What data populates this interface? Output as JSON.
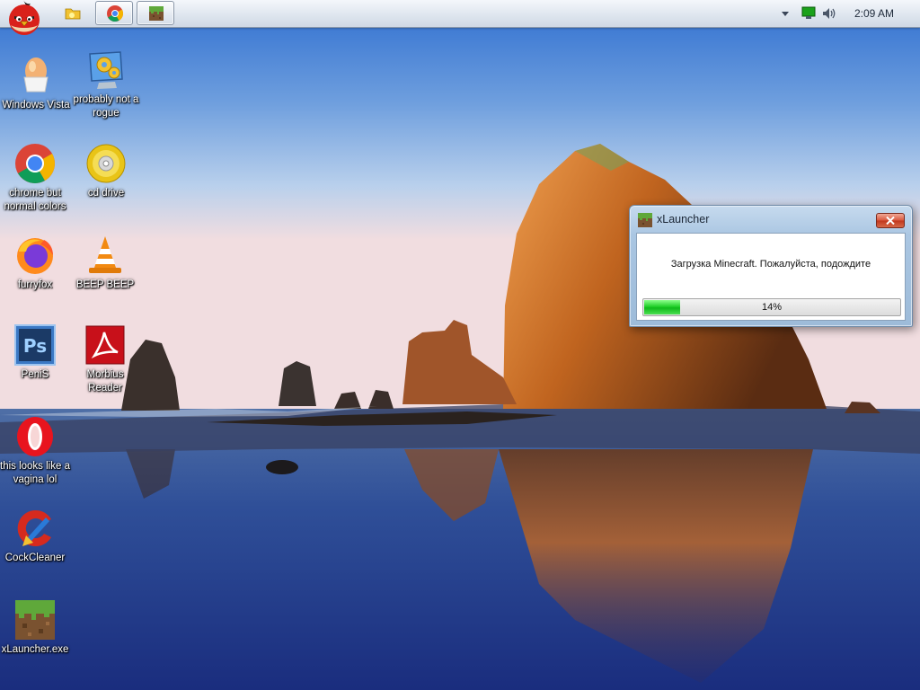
{
  "taskbar": {
    "start_icon": "angry-bird-icon",
    "quicklaunch_icon": "folder-icon",
    "tasks": [
      {
        "name": "chrome",
        "icon": "chrome-icon"
      },
      {
        "name": "xlauncher",
        "icon": "minecraft-grass-block-icon"
      }
    ],
    "tray": {
      "chevron": "chevron-down-icon",
      "network": "network-icon",
      "volume": "speaker-icon",
      "clock": "2:09 AM"
    }
  },
  "desktop": {
    "icons": [
      {
        "label": "Windows Vista",
        "icon": "egg-icon"
      },
      {
        "label": "probably not a rogue",
        "icon": "monitor-gears-icon"
      },
      {
        "label": "chrome but normal colors",
        "icon": "chrome-icon"
      },
      {
        "label": "cd drive",
        "icon": "cd-icon"
      },
      {
        "label": "furryfox",
        "icon": "firefox-icon"
      },
      {
        "label": "BEEP BEEP",
        "icon": "vlc-cone-icon"
      },
      {
        "label": "PeniS",
        "icon": "photoshop-icon"
      },
      {
        "label": "Morbius Reader",
        "icon": "acrobat-icon"
      },
      {
        "label": "this looks like a vagina lol",
        "icon": "opera-icon"
      },
      {
        "label": "CockCleaner",
        "icon": "ccleaner-icon"
      },
      {
        "label": "xLauncher.exe",
        "icon": "minecraft-grass-block-icon"
      }
    ]
  },
  "window": {
    "title": "xLauncher",
    "title_icon": "minecraft-grass-block-icon",
    "close_icon": "close-icon",
    "message": "Загрузка Minecraft. Пожалуйста, подождите",
    "progress": {
      "value": 0.14,
      "label": "14%"
    }
  },
  "colors": {
    "progress_green": "#22d02a",
    "close_red": "#c1361c",
    "titlebar_blue": "#aac6e2"
  }
}
